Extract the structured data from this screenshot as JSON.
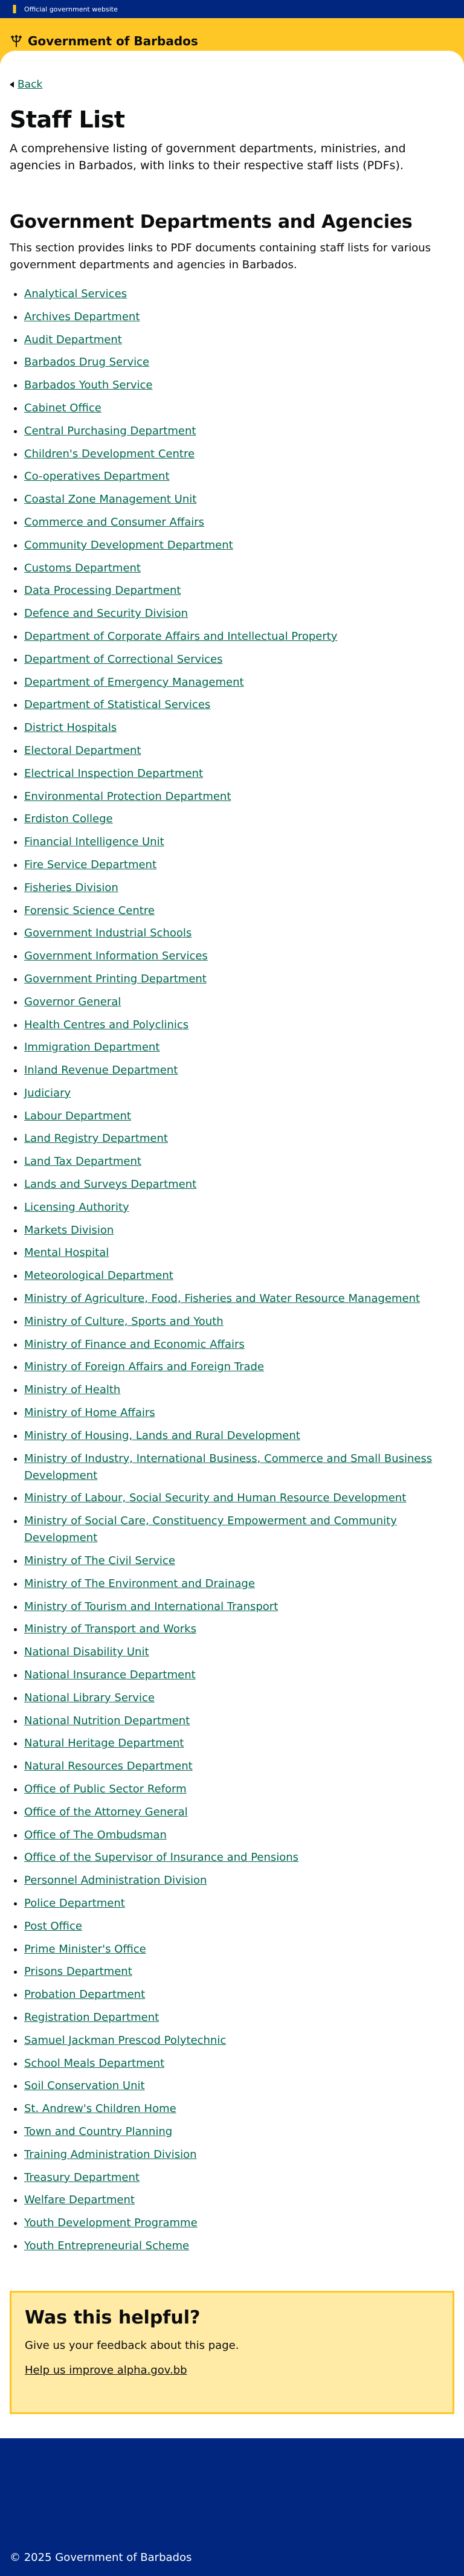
{
  "top_strip": {
    "text": "Official government website"
  },
  "header": {
    "title": "Government of Barbados"
  },
  "back": {
    "label": "Back"
  },
  "page": {
    "title": "Staff List",
    "intro": "A comprehensive listing of government departments, ministries, and agencies in Barbados, with links to their respective staff lists (PDFs)."
  },
  "section": {
    "heading": "Government Departments and Agencies",
    "description": "This section provides links to PDF documents containing staff lists for various government departments and agencies in Barbados."
  },
  "departments": [
    "Analytical Services",
    "Archives Department",
    "Audit Department",
    "Barbados Drug Service",
    "Barbados Youth Service",
    "Cabinet Office",
    "Central Purchasing Department",
    "Children's Development Centre",
    "Co-operatives Department",
    "Coastal Zone Management Unit",
    "Commerce and Consumer Affairs",
    "Community Development Department",
    "Customs Department",
    "Data Processing Department",
    "Defence and Security Division",
    "Department of Corporate Affairs and Intellectual Property",
    "Department of Correctional Services",
    "Department of Emergency Management",
    "Department of Statistical Services",
    "District Hospitals",
    "Electoral Department",
    "Electrical Inspection Department",
    "Environmental Protection Department",
    "Erdiston College",
    "Financial Intelligence Unit",
    "Fire Service Department",
    "Fisheries Division",
    "Forensic Science Centre",
    "Government Industrial Schools",
    "Government Information Services",
    "Government Printing Department",
    "Governor General",
    "Health Centres and Polyclinics",
    "Immigration Department",
    "Inland Revenue Department",
    "Judiciary",
    "Labour Department",
    "Land Registry Department",
    "Land Tax Department",
    "Lands and Surveys Department",
    "Licensing Authority",
    "Markets Division",
    "Mental Hospital",
    "Meteorological Department",
    "Ministry of Agriculture, Food, Fisheries and Water Resource Management",
    "Ministry of Culture, Sports and Youth",
    "Ministry of Finance and Economic Affairs",
    "Ministry of Foreign Affairs and Foreign Trade",
    "Ministry of Health",
    "Ministry of Home Affairs",
    "Ministry of Housing, Lands and Rural Development",
    "Ministry of Industry, International Business, Commerce and Small Business Development",
    "Ministry of Labour, Social Security and Human Resource Development",
    "Ministry of Social Care, Constituency Empowerment and Community Development",
    "Ministry of The Civil Service",
    "Ministry of The Environment and Drainage",
    "Ministry of Tourism and International Transport",
    "Ministry of Transport and Works",
    "National Disability Unit",
    "National Insurance Department",
    "National Library Service",
    "National Nutrition Department",
    "Natural Heritage Department",
    "Natural Resources Department",
    "Office of Public Sector Reform",
    "Office of the Attorney General",
    "Office of The Ombudsman",
    "Office of the Supervisor of Insurance and Pensions",
    "Personnel Administration Division",
    "Police Department",
    "Post Office",
    "Prime Minister's Office",
    "Prisons Department",
    "Probation Department",
    "Registration Department",
    "Samuel Jackman Prescod Polytechnic",
    "School Meals Department",
    "Soil Conservation Unit",
    "St. Andrew's Children Home",
    "Town and Country Planning",
    "Training Administration Division",
    "Treasury Department",
    "Welfare Department",
    "Youth Development Programme",
    "Youth Entrepreneurial Scheme"
  ],
  "feedback": {
    "title": "Was this helpful?",
    "text": "Give us your feedback about this page.",
    "link": "Help us improve alpha.gov.bb"
  },
  "footer": {
    "copyright": "© 2025 Government of Barbados"
  },
  "colors": {
    "navy": "#00267f",
    "gold": "#ffc726",
    "link_green": "#00654f",
    "feedback_bg": "#ffeba6"
  }
}
